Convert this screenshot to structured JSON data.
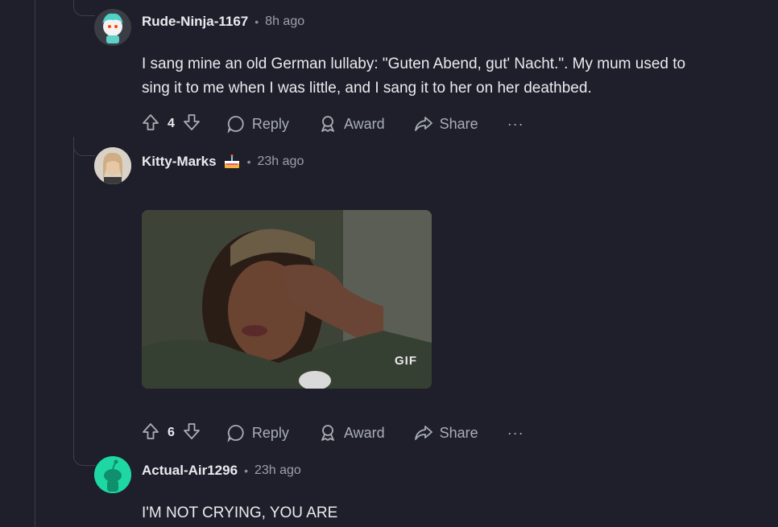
{
  "comments": [
    {
      "author": "Rude-Ninja-1167",
      "time": "8h ago",
      "body_line1": "I sang mine an old German lullaby: \"Guten Abend, gut' Nacht.\". My mum used to",
      "body_line2": "sing it to me when I was little, and I sang it to her on her deathbed.",
      "votes": "4",
      "reply_label": "Reply",
      "award_label": "Award",
      "share_label": "Share",
      "more_label": "···"
    },
    {
      "author": "Kitty-Marks",
      "flair_icon": "cake-icon",
      "time": "23h ago",
      "gif_label": "GIF",
      "votes": "6",
      "reply_label": "Reply",
      "award_label": "Award",
      "share_label": "Share",
      "more_label": "···"
    },
    {
      "author": "Actual-Air1296",
      "time": "23h ago",
      "body": "I'M NOT CRYING, YOU ARE"
    }
  ],
  "separator": "•",
  "colors": {
    "background": "#1f1f2b",
    "thread_line": "#3c3f47",
    "text": "#e8ebee",
    "muted": "#a8aeb4",
    "avatar_green": "#1ed8a3"
  }
}
